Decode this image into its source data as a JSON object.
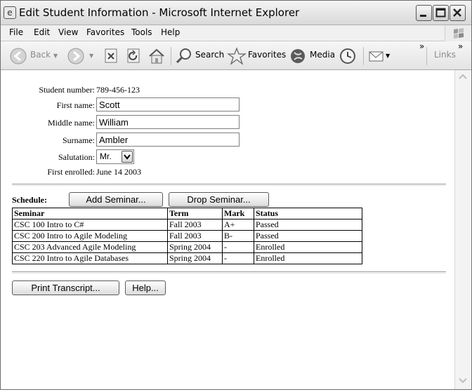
{
  "window": {
    "title": "Edit Student Information - Microsoft Internet Explorer"
  },
  "menu": [
    "File",
    "Edit",
    "View",
    "Favorites",
    "Tools",
    "Help"
  ],
  "toolbar": {
    "back": "Back",
    "search": "Search",
    "favorites": "Favorites",
    "media": "Media",
    "more": "»",
    "links": "Links",
    "links_more": "»"
  },
  "form": {
    "student_number_label": "Student number:",
    "student_number": "789-456-123",
    "first_name_label": "First name:",
    "first_name": "Scott",
    "middle_name_label": "Middle name:",
    "middle_name": "William",
    "surname_label": "Surname:",
    "surname": "Ambler",
    "salutation_label": "Salutation:",
    "salutation": "Mr.",
    "first_enrolled_label": "First enrolled:",
    "first_enrolled": "June 14 2003"
  },
  "schedule": {
    "label": "Schedule:",
    "add_button": "Add Seminar...",
    "drop_button": "Drop Seminar...",
    "columns": [
      "Seminar",
      "Term",
      "Mark",
      "Status"
    ],
    "rows": [
      [
        "CSC 100 Intro to C#",
        "Fall 2003",
        "A+",
        "Passed"
      ],
      [
        "CSC 200 Intro to Agile Modeling",
        "Fall 2003",
        "B-",
        "Passed"
      ],
      [
        "CSC 203 Advanced Agile Modeling",
        "Spring 2004",
        "-",
        "Enrolled"
      ],
      [
        "CSC 220 Intro to Agile Databases",
        "Spring 2004",
        "-",
        "Enrolled"
      ]
    ]
  },
  "actions": {
    "print": "Print Transcript...",
    "help": "Help..."
  }
}
